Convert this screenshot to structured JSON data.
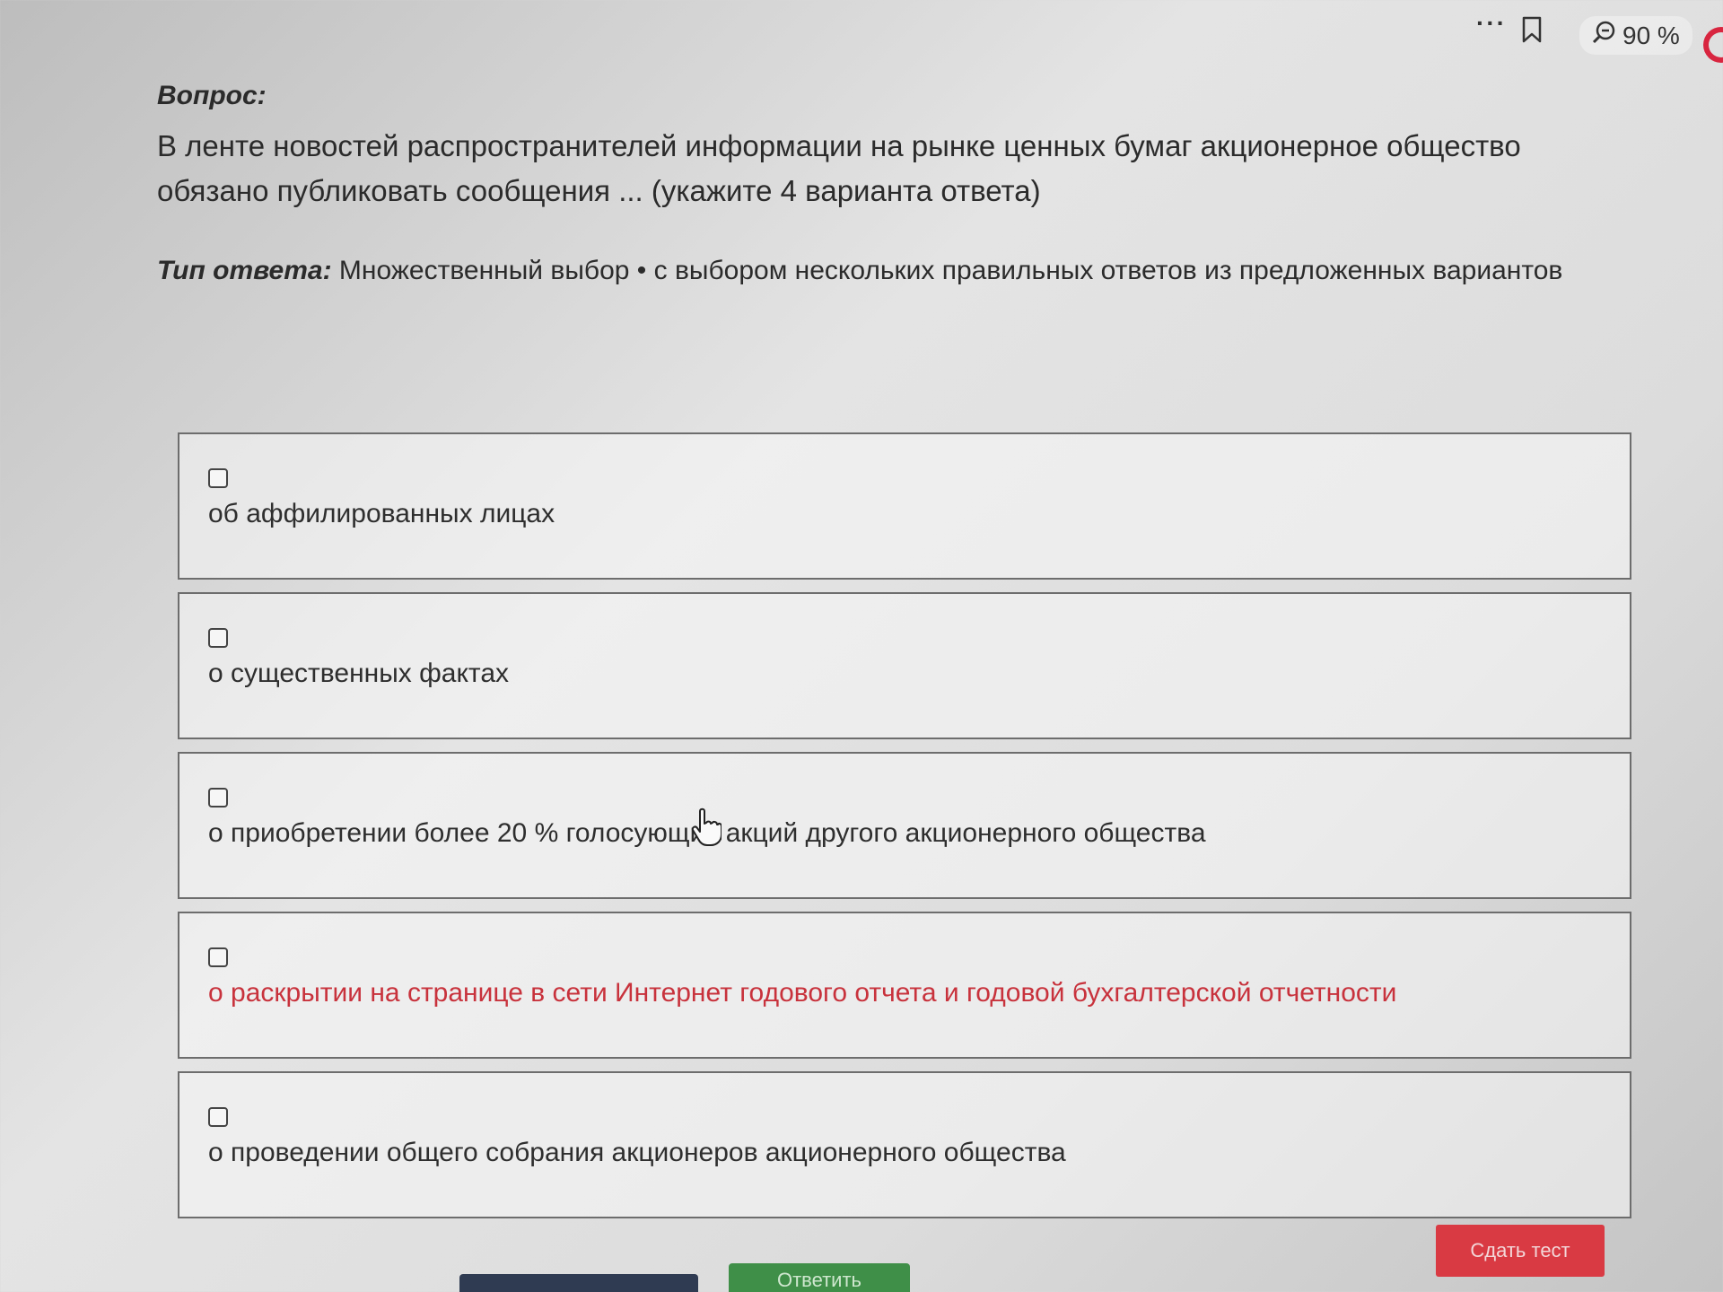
{
  "toolbar": {
    "more_icon": "more-dots-icon",
    "bookmark_icon": "bookmark-icon",
    "zoom_icon": "zoom-out-icon",
    "zoom_value": "90 %"
  },
  "question": {
    "label": "Вопрос:",
    "text": "В ленте новостей распространителей информации на рынке ценных бумаг акционерное общество обязано публиковать сообщения ... (укажите 4 варианта ответа)"
  },
  "answer_type": {
    "label": "Тип ответа:",
    "value": "Множественный выбор • с выбором нескольких правильных ответов из предложенных вариантов"
  },
  "options": [
    {
      "label": "об аффилированных лицах",
      "checked": false
    },
    {
      "label": "о существенных фактах",
      "checked": false
    },
    {
      "label": "о приобретении более 20 % голосующих акций другого акционерного общества",
      "checked": false
    },
    {
      "label": "о раскрытии на странице в сети Интернет годового отчета и годовой бухгалтерской отчетности",
      "checked": false,
      "hovered": true
    },
    {
      "label": "о проведении общего собрания акционеров акционерного общества",
      "checked": false
    }
  ],
  "buttons": {
    "submit_label": "Сдать тест",
    "answer_label": "Ответить"
  },
  "colors": {
    "submit": "#d93a43",
    "answer": "#3f8f48",
    "hover_text": "#c8323c"
  }
}
